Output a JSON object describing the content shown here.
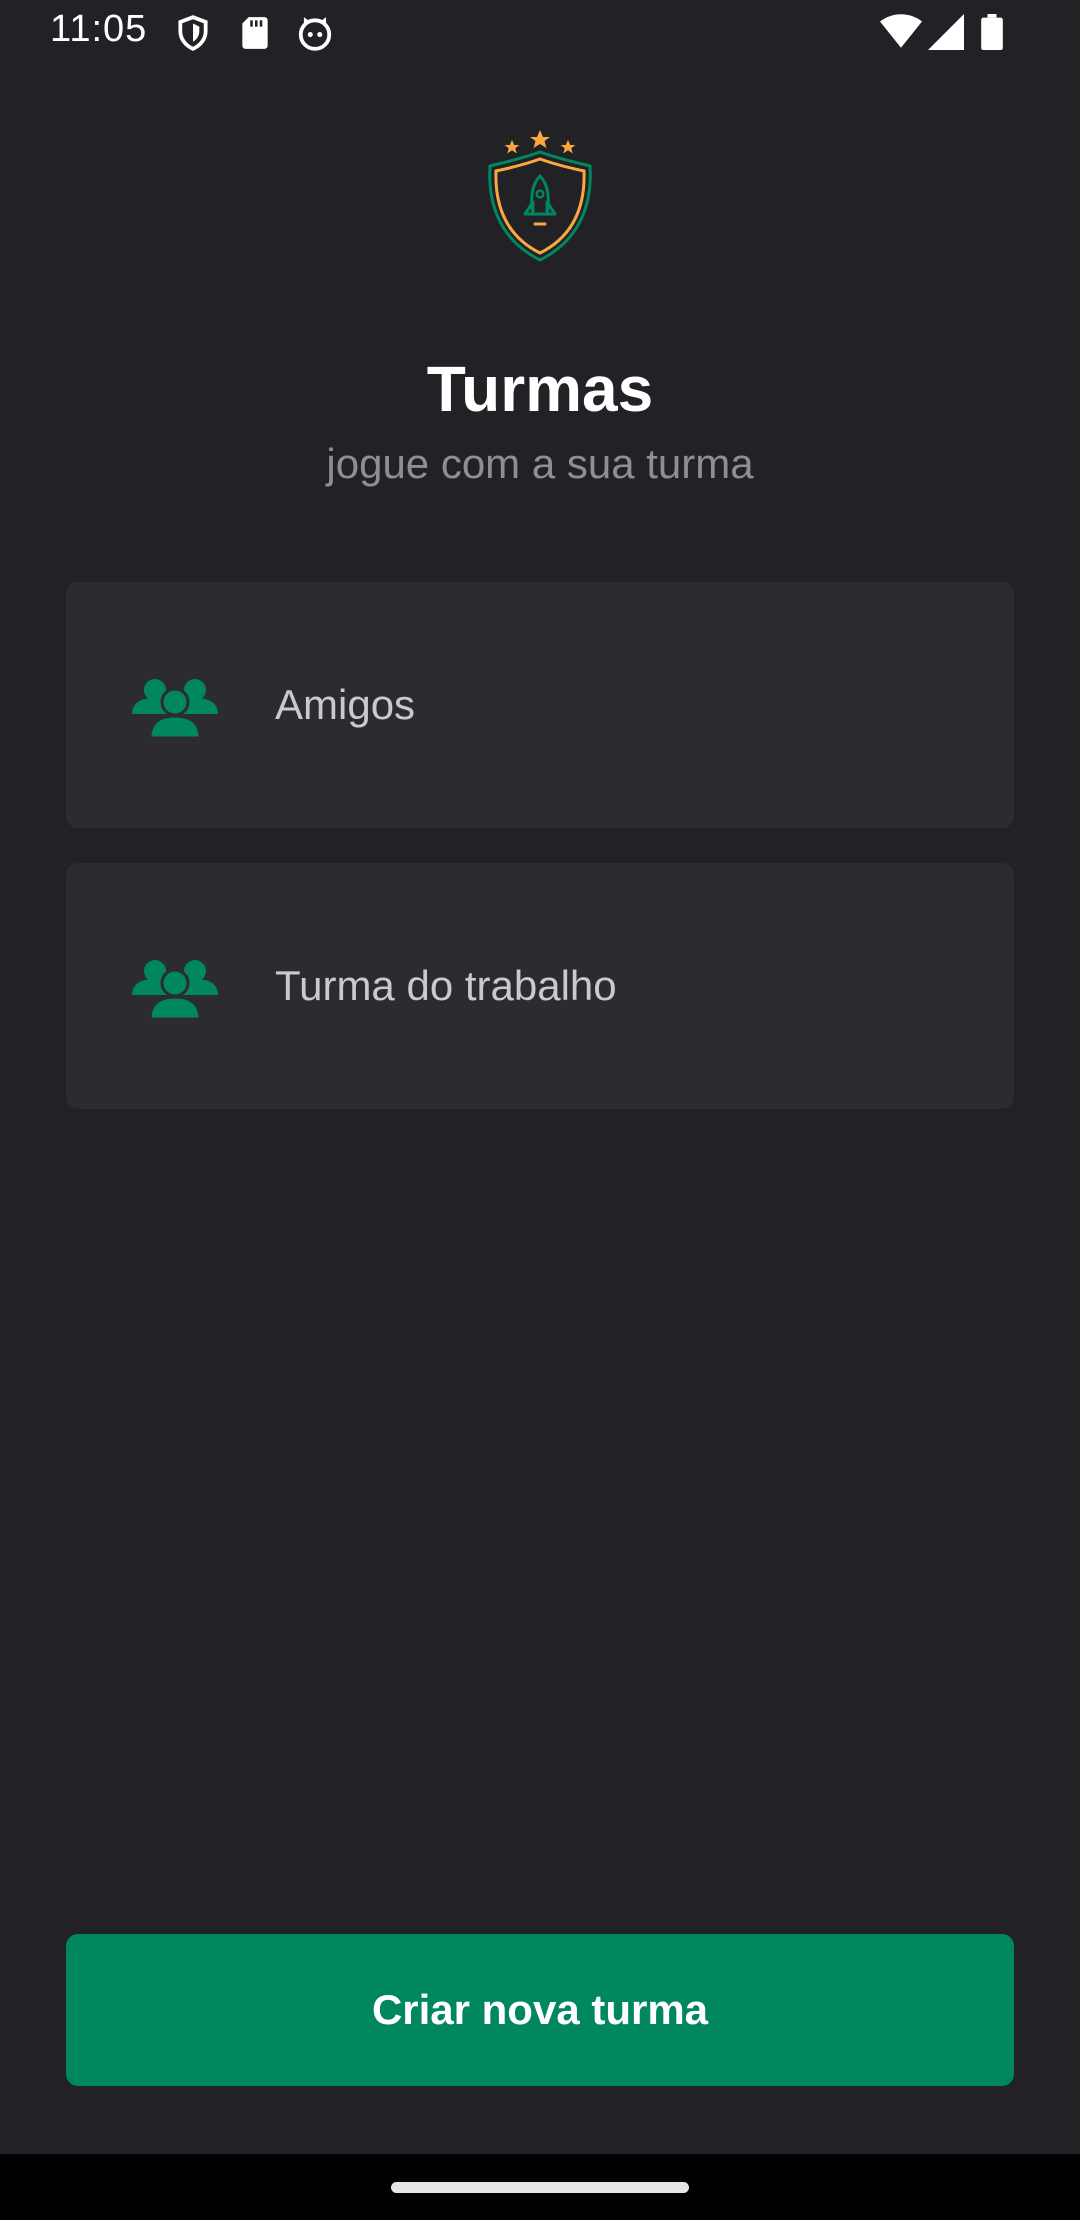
{
  "status_bar": {
    "time": "11:05",
    "left_icons": [
      "shield-icon",
      "sd-card-icon",
      "cat-face-icon"
    ],
    "right_icons": [
      "wifi-icon",
      "cellular-signal-icon",
      "battery-icon"
    ]
  },
  "header": {
    "logo_icon": "rocket-shield-logo-icon",
    "title": "Turmas",
    "subtitle": "jogue com a sua turma"
  },
  "groups": [
    {
      "name": "Amigos",
      "icon": "users-group-icon"
    },
    {
      "name": "Turma do trabalho",
      "icon": "users-group-icon"
    }
  ],
  "actions": {
    "create_label": "Criar nova turma"
  },
  "colors": {
    "background": "#212126",
    "card": "#2b2b31",
    "accent_green": "#00875f",
    "icon_green": "#00875f",
    "logo_orange": "#f7a940",
    "text_primary": "#ffffff",
    "text_secondary": "#8e8e96"
  }
}
